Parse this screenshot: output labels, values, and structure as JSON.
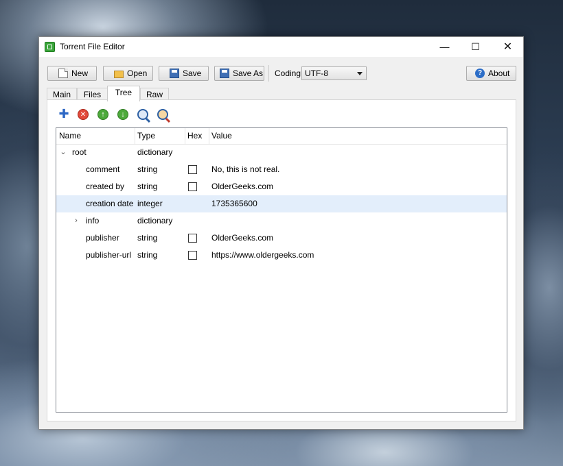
{
  "window": {
    "title": "Torrent File Editor",
    "controls": {
      "minimize": "—",
      "maximize": "☐",
      "close": "✕"
    }
  },
  "toolbar": {
    "new_label": "New",
    "open_label": "Open",
    "save_label": "Save",
    "save_as_label": "Save As",
    "coding_label": "Coding",
    "coding_value": "UTF-8",
    "about_label": "About",
    "about_glyph": "?"
  },
  "tabs": [
    {
      "label": "Main"
    },
    {
      "label": "Files"
    },
    {
      "label": "Tree",
      "active": true
    },
    {
      "label": "Raw"
    }
  ],
  "actions": {
    "add_glyph": "✚",
    "remove_glyph": "✕",
    "up_glyph": "↑",
    "down_glyph": "↓"
  },
  "tree": {
    "columns": [
      "Name",
      "Type",
      "Hex",
      "Value"
    ],
    "rows": [
      {
        "name": "root",
        "type": "dictionary",
        "hex": null,
        "value": "",
        "expander": "⌄"
      },
      {
        "name": "comment",
        "type": "string",
        "hex": false,
        "value": "No, this is not real."
      },
      {
        "name": "created by",
        "type": "string",
        "hex": false,
        "value": "OlderGeeks.com"
      },
      {
        "name": "creation date",
        "type": "integer",
        "hex": null,
        "value": "1735365600",
        "selected": true
      },
      {
        "name": "info",
        "type": "dictionary",
        "hex": null,
        "value": "",
        "expander": "›"
      },
      {
        "name": "publisher",
        "type": "string",
        "hex": false,
        "value": "OlderGeeks.com"
      },
      {
        "name": "publisher-url",
        "type": "string",
        "hex": false,
        "value": "https://www.oldergeeks.com"
      }
    ]
  }
}
